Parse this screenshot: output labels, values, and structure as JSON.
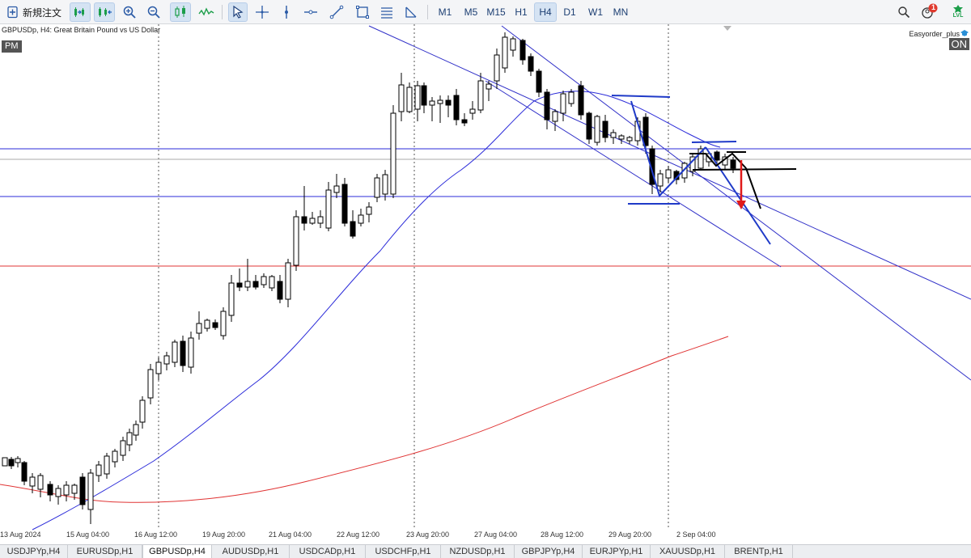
{
  "toolbar": {
    "new_order_label": "新規注文",
    "timeframes": [
      {
        "label": "M1",
        "active": false
      },
      {
        "label": "M5",
        "active": false
      },
      {
        "label": "M15",
        "active": false
      },
      {
        "label": "H1",
        "active": false
      },
      {
        "label": "H4",
        "active": true
      },
      {
        "label": "D1",
        "active": false
      },
      {
        "label": "W1",
        "active": false
      },
      {
        "label": "MN",
        "active": false
      }
    ],
    "notification_count": "1",
    "lvl_label": "LVL"
  },
  "chart": {
    "title": "GBPUSDp, H4:  Great Britain Pound vs US Dollar",
    "pm_badge": "PM",
    "ea_name": "Easyorder_plus",
    "ea_status": "ON",
    "x_labels": [
      "13 Aug 2024",
      "15 Aug 04:00",
      "16 Aug 12:00",
      "19 Aug 20:00",
      "21 Aug 04:00",
      "22 Aug 12:00",
      "23 Aug 20:00",
      "27 Aug 04:00",
      "28 Aug 12:00",
      "29 Aug 20:00",
      "2 Sep 04:00"
    ],
    "colors": {
      "candles": "#000000",
      "ma_fast": "#2b2bd9",
      "ma_slow": "#e03434",
      "horizontal_blue": "#2b2bd9",
      "horizontal_red": "#e03434",
      "channel": "#3030c8",
      "arrow": "#e01919"
    }
  },
  "tabs": [
    {
      "label": "USDJPYp,H4",
      "active": false
    },
    {
      "label": "EURUSDp,H1",
      "active": false
    },
    {
      "label": "GBPUSDp,H4",
      "active": true
    },
    {
      "label": "AUDUSDp,H1",
      "active": false
    },
    {
      "label": "USDCADp,H1",
      "active": false
    },
    {
      "label": "USDCHFp,H1",
      "active": false
    },
    {
      "label": "NZDUSDp,H1",
      "active": false
    },
    {
      "label": "GBPJPYp,H4",
      "active": false
    },
    {
      "label": "EURJPYp,H1",
      "active": false
    },
    {
      "label": "XAUUSDp,H1",
      "active": false
    },
    {
      "label": "BRENTp,H1",
      "active": false
    }
  ]
}
